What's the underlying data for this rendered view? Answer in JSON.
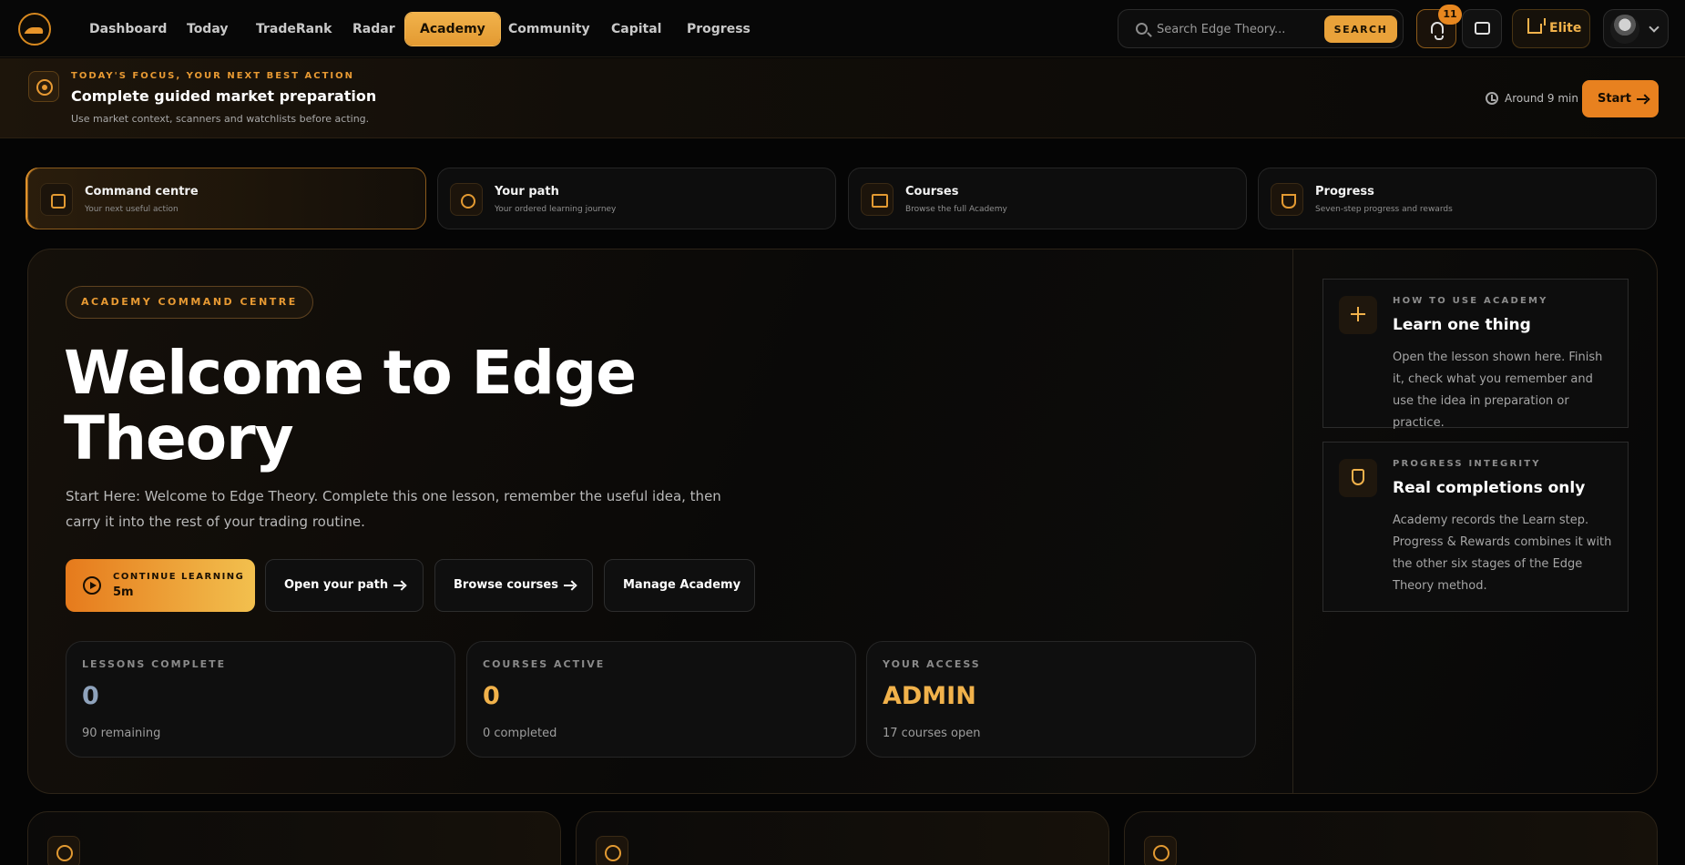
{
  "nav": {
    "links": [
      "Dashboard",
      "Today",
      "TradeRank",
      "Radar",
      "Academy",
      "Community",
      "Capital",
      "Progress"
    ],
    "active": "Academy",
    "search_placeholder": "Search Edge Theory...",
    "search_button": "SEARCH",
    "notification_count": "11",
    "plan_label": "Elite",
    "accent_color": "#e9a23a"
  },
  "focus": {
    "eyebrow": "TODAY'S FOCUS, YOUR NEXT BEST ACTION",
    "title": "Complete guided market preparation",
    "subtitle": "Use market context, scanners and watchlists before acting.",
    "time": "Around 9 min",
    "start_label": "Start"
  },
  "tabs": [
    {
      "title": "Command centre",
      "subtitle": "Your next useful action",
      "icon": "grid-icon"
    },
    {
      "title": "Your path",
      "subtitle": "Your ordered learning journey",
      "icon": "compass-icon"
    },
    {
      "title": "Courses",
      "subtitle": "Browse the full Academy",
      "icon": "book-icon"
    },
    {
      "title": "Progress",
      "subtitle": "Seven-step progress and rewards",
      "icon": "trophy-icon"
    }
  ],
  "hero": {
    "pill": "ACADEMY COMMAND CENTRE",
    "title": "Welcome to Edge Theory",
    "description": "Start Here: Welcome to Edge Theory. Complete this one lesson, remember the useful idea, then carry it into the rest of your trading routine.",
    "continue_label": "CONTINUE LEARNING",
    "continue_duration": "5m",
    "open_path_label": "Open your path",
    "browse_label": "Browse courses",
    "manage_label": "Manage Academy"
  },
  "stats": [
    {
      "label": "LESSONS COMPLETE",
      "value": "0",
      "sub": "90 remaining",
      "color": "#8fa3bc"
    },
    {
      "label": "COURSES ACTIVE",
      "value": "0",
      "sub": "0 completed",
      "color": "#f1b24b"
    },
    {
      "label": "YOUR ACCESS",
      "value": "ADMIN",
      "sub": "17 courses open",
      "color": "#f1b24b"
    }
  ],
  "side_cards": [
    {
      "eyebrow": "HOW TO USE ACADEMY",
      "title": "Learn one thing",
      "body": "Open the lesson shown here. Finish it, check what you remember and use the idea in preparation or practice.",
      "icon": "sparkle-icon"
    },
    {
      "eyebrow": "PROGRESS INTEGRITY",
      "title": "Real completions only",
      "body": "Academy records the Learn step. Progress & Rewards combines it with the other six stages of the Edge Theory method.",
      "icon": "shield-icon"
    }
  ]
}
